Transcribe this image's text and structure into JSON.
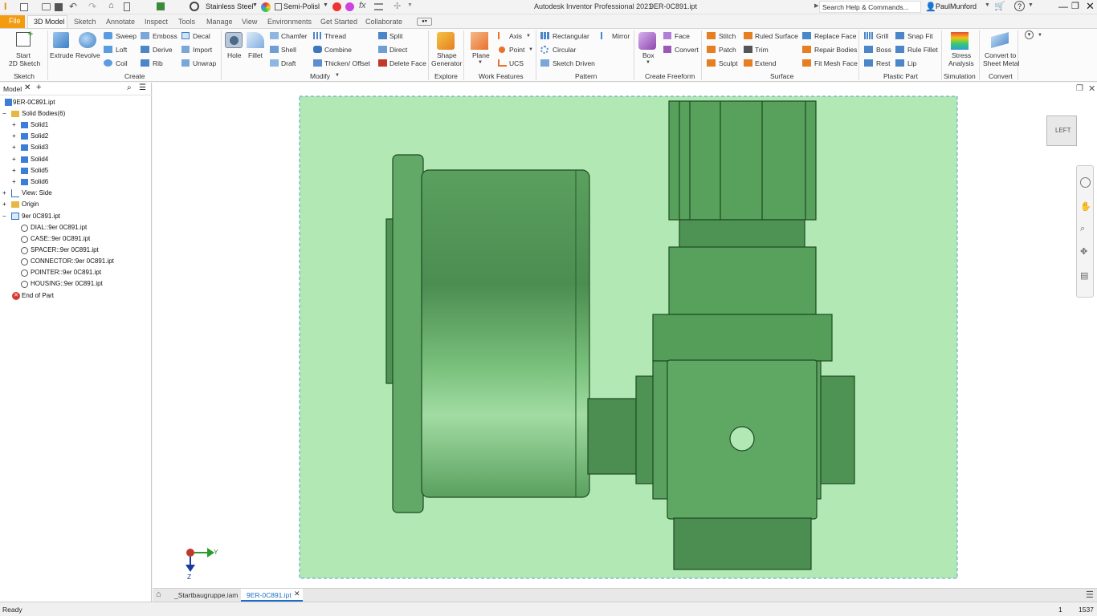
{
  "titlebar": {
    "material": "Stainless Steel",
    "appearance": "Semi-Polisl",
    "app_title": "Autodesk Inventor Professional 2021",
    "file_title": "9ER-0C891.ipt",
    "search_placeholder": "Search Help & Commands...",
    "user": "PaulMunford"
  },
  "tabs": [
    "File",
    "3D Model",
    "Sketch",
    "Annotate",
    "Inspect",
    "Tools",
    "Manage",
    "View",
    "Environments",
    "Get Started",
    "Collaborate"
  ],
  "ribbon": {
    "start_sketch": "Start",
    "start_sketch2": "2D Sketch",
    "extrude": "Extrude",
    "revolve": "Revolve",
    "sweep": "Sweep",
    "emboss": "Emboss",
    "decal": "Decal",
    "loft": "Loft",
    "derive": "Derive",
    "import": "Import",
    "coil": "Coil",
    "rib": "Rib",
    "unwrap": "Unwrap",
    "hole": "Hole",
    "fillet": "Fillet",
    "chamfer": "Chamfer",
    "thread": "Thread",
    "split": "Split",
    "shell": "Shell",
    "combine": "Combine",
    "direct": "Direct",
    "draft": "Draft",
    "thicken": "Thicken/ Offset",
    "delete_face": "Delete Face",
    "shape_gen1": "Shape",
    "shape_gen2": "Generator",
    "plane": "Plane",
    "axis": "Axis",
    "point": "Point",
    "ucs": "UCS",
    "rectangular": "Rectangular",
    "mirror": "Mirror",
    "circular": "Circular",
    "sketch_driven": "Sketch Driven",
    "box": "Box",
    "face": "Face",
    "convert": "Convert",
    "stitch": "Stitch",
    "ruled_surface": "Ruled Surface",
    "replace_face": "Replace Face",
    "patch": "Patch",
    "trim": "Trim",
    "repair_bodies": "Repair Bodies",
    "sculpt": "Sculpt",
    "extend": "Extend",
    "fit_mesh_face": "Fit Mesh Face",
    "grill": "Grill",
    "snap_fit": "Snap Fit",
    "boss": "Boss",
    "rule_fillet": "Rule Fillet",
    "rest": "Rest",
    "lip": "Lip",
    "stress1": "Stress",
    "stress2": "Analysis",
    "sheet1": "Convert to",
    "sheet2": "Sheet Metal",
    "groups": {
      "sketch": "Sketch",
      "create": "Create",
      "modify": "Modify",
      "explore": "Explore",
      "work": "Work Features",
      "pattern": "Pattern",
      "freeform": "Create Freeform",
      "surface": "Surface",
      "plastic": "Plastic Part",
      "simulation": "Simulation",
      "convert": "Convert"
    }
  },
  "browser": {
    "tab": "Model",
    "root": "9ER-0C891.ipt",
    "solid_bodies": "Solid Bodies(6)",
    "solids": [
      "Solid1",
      "Solid2",
      "Solid3",
      "Solid4",
      "Solid5",
      "Solid6"
    ],
    "view": "View: Side",
    "origin": "Origin",
    "part": "9er 0C891.ipt",
    "derived": [
      "DIAL::9er 0C891.ipt",
      "CASE::9er 0C891.ipt",
      "SPACER::9er 0C891.ipt",
      "CONNECTOR::9er 0C891.ipt",
      "POINTER::9er 0C891.ipt",
      "HOUSING::9er 0C891.ipt"
    ],
    "end": "End of Part"
  },
  "viewcube_label": "LEFT",
  "triad": {
    "y": "Y",
    "z": "Z"
  },
  "doctabs": [
    "_Startbaugruppe.iam",
    "9ER-0C891.ipt"
  ],
  "status": {
    "left": "Ready",
    "count1": "1",
    "count2": "1537"
  },
  "colors": {
    "selection_bg": "#b2e8b4",
    "part_green": "#5aa05e",
    "accent_blue": "#1a6fc4"
  }
}
